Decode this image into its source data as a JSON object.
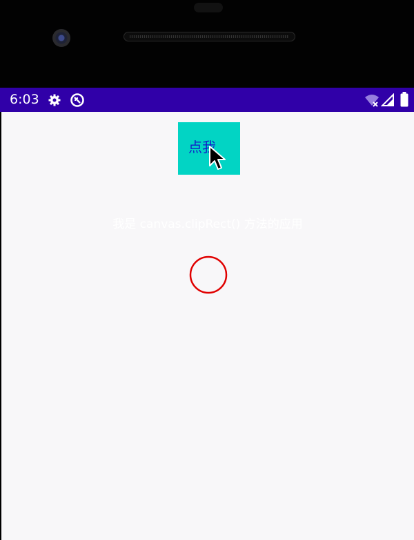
{
  "status_bar": {
    "time": "6:03",
    "background_color": "#3000a8",
    "icons": [
      "gear-icon",
      "sync-icon",
      "wifi-off-icon",
      "signal-icon",
      "battery-icon"
    ]
  },
  "app": {
    "button_label": "点我",
    "button_color": "#02d4c4",
    "button_text_color": "#1220c8",
    "caption": "我是 canvas.clipRect() 方法的应用",
    "circle_color": "#e00000",
    "background_color": "#f8f7f9"
  }
}
